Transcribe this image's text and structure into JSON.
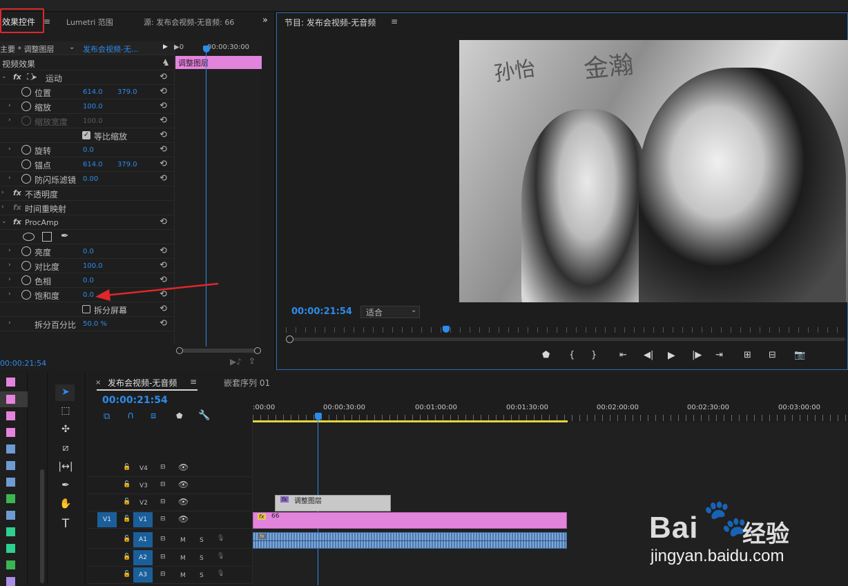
{
  "effect_controls": {
    "tab_active": "效果控件",
    "tab_lumetri": "Lumetri 范围",
    "tab_source": "源: 发布会视频-无音频: 66",
    "master_label": "主要 * 调整图层",
    "sequence_label": "发布会视频-无...",
    "mini_time": "00:00:30:00",
    "mini_clip": "调整图层",
    "video_effects": "视频效果",
    "motion": "运动",
    "position": {
      "label": "位置",
      "x": "614.0",
      "y": "379.0"
    },
    "scale": {
      "label": "缩放",
      "value": "100.0"
    },
    "scale_width": {
      "label": "缩放宽度",
      "value": "100.0"
    },
    "uniform_scale": "等比缩放",
    "rotation": {
      "label": "旋转",
      "value": "0.0"
    },
    "anchor": {
      "label": "锚点",
      "x": "614.0",
      "y": "379.0"
    },
    "antiflicker": {
      "label": "防闪烁滤镜",
      "value": "0.00"
    },
    "opacity": "不透明度",
    "time_remap": "时间重映射",
    "procamp": "ProcAmp",
    "brightness": {
      "label": "亮度",
      "value": "0.0"
    },
    "contrast": {
      "label": "对比度",
      "value": "100.0"
    },
    "hue": {
      "label": "色相",
      "value": "0.0"
    },
    "saturation": {
      "label": "饱和度",
      "value": "0.0"
    },
    "split_screen": "拆分屏幕",
    "split_percent": {
      "label": "拆分百分比",
      "value": "50.0 %"
    },
    "time": "00:00:21:54"
  },
  "program": {
    "title": "节目: 发布会视频-无音频",
    "timecode": "00:00:21:54",
    "fit": "适合",
    "image_text_left": "孙怡",
    "image_text_right": "金瀚"
  },
  "timeline": {
    "tab_active": "发布会视频-无音频",
    "tab_other": "嵌套序列 01",
    "timecode": "00:00:21:54",
    "ruler": [
      ":00:00",
      "00:00:30:00",
      "00:01:00:00",
      "00:01:30:00",
      "00:02:00:00",
      "00:02:30:00",
      "00:03:00:00"
    ],
    "tracks": {
      "v4": "V4",
      "v3": "V3",
      "v2": "V2",
      "v1_src": "V1",
      "v1": "V1",
      "a1": "A1",
      "a2": "A2",
      "a3": "A3",
      "m": "M",
      "s": "S"
    },
    "clip_adjust": "调整图层",
    "clip_video": "66",
    "fx": "fx"
  },
  "watermark": {
    "brand": "Bai du 经验",
    "url": "jingyan.baidu.com"
  },
  "colors": {
    "accent": "#2d8ceb",
    "clip_pink": "#e384dc",
    "highlight": "#e0272b"
  }
}
